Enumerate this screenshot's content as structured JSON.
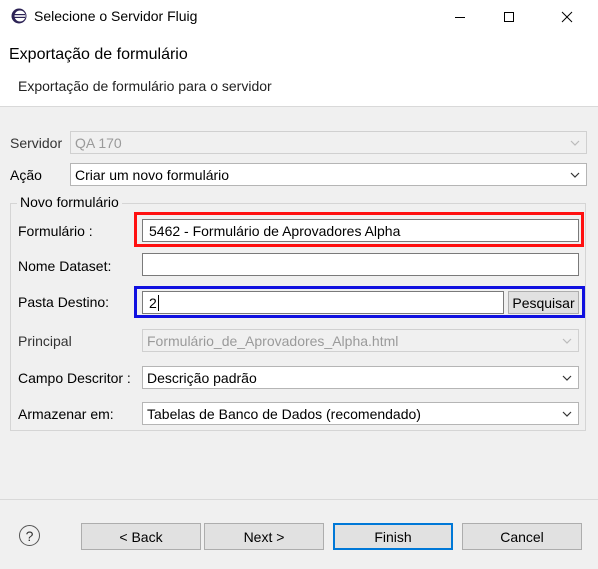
{
  "window": {
    "title": "Selecione o Servidor Fluig",
    "minimize_icon": "minimize-icon",
    "maximize_icon": "maximize-icon",
    "close_icon": "close-icon"
  },
  "header": {
    "title": "Exportação de formulário",
    "description": "Exportação de formulário para o servidor"
  },
  "form": {
    "servidor": {
      "label": "Servidor",
      "value": "QA 170"
    },
    "acao": {
      "label": "Ação",
      "value": "Criar um novo formulário"
    },
    "group_title": "Novo formulário",
    "formulario": {
      "label": "Formulário :",
      "value": "5462 - Formulário de Aprovadores Alpha"
    },
    "nome_dataset": {
      "label": "Nome Dataset:",
      "value": ""
    },
    "pasta_destino": {
      "label": "Pasta Destino:",
      "value": "2",
      "button": "Pesquisar"
    },
    "principal": {
      "label": "Principal",
      "value": "Formulário_de_Aprovadores_Alpha.html"
    },
    "campo_descritor": {
      "label": "Campo Descritor :",
      "value": "Descrição padrão"
    },
    "armazenar_em": {
      "label": "Armazenar em:",
      "value": "Tabelas de Banco de Dados (recomendado)"
    }
  },
  "footer": {
    "help_glyph": "?",
    "back": "< Back",
    "next": "Next >",
    "finish": "Finish",
    "cancel": "Cancel"
  },
  "colors": {
    "highlight_red": "#ff1010",
    "highlight_blue": "#1010e0",
    "default_button_border": "#0078d7"
  }
}
